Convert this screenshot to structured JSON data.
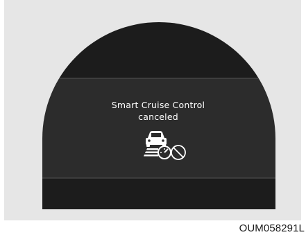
{
  "display": {
    "message_line1": "Smart Cruise Control",
    "message_line2": "canceled",
    "icon": "smart-cruise-canceled-icon"
  },
  "caption": "OUM058291L",
  "colors": {
    "frame": "#e6e6e6",
    "screen": "#2a2a2a",
    "band": "#1c1c1c",
    "text": "#ffffff"
  }
}
